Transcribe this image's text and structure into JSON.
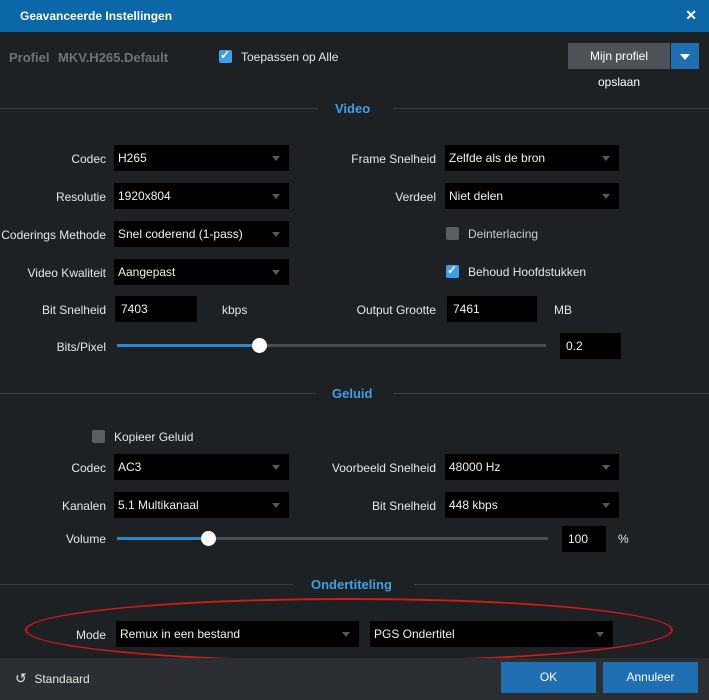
{
  "window": {
    "title": "Geavanceerde Instellingen",
    "close": "✕"
  },
  "profile": {
    "label": "Profiel",
    "name": "MKV.H265.Default",
    "apply_all_label": "Toepassen op Alle",
    "apply_all_checked": true,
    "save_label": "Mijn profiel opslaan"
  },
  "video": {
    "section_title": "Video",
    "codec": {
      "label": "Codec",
      "value": "H265"
    },
    "resolution": {
      "label": "Resolutie",
      "value": "1920x804"
    },
    "encoding_method": {
      "label": "Coderings Methode",
      "value": "Snel coderend (1-pass)"
    },
    "quality": {
      "label": "Video Kwaliteit",
      "value": "Aangepast"
    },
    "bitrate": {
      "label": "Bit Snelheid",
      "value": "7403",
      "unit": "kbps"
    },
    "bits_per_pixel": {
      "label": "Bits/Pixel",
      "value": "0.2",
      "level": 0.33
    },
    "frame_rate": {
      "label": "Frame Snelheid",
      "value": "Zelfde als de bron"
    },
    "split": {
      "label": "Verdeel",
      "value": "Niet delen"
    },
    "deinterlacing": {
      "label": "Deinterlacing",
      "checked": false
    },
    "keep_chapters": {
      "label": "Behoud Hoofdstukken",
      "checked": true
    },
    "output_size": {
      "label": "Output Grootte",
      "value": "7461",
      "unit": "MB"
    }
  },
  "audio": {
    "section_title": "Geluid",
    "copy_audio": {
      "label": "Kopieer Geluid",
      "checked": false
    },
    "codec": {
      "label": "Codec",
      "value": "AC3"
    },
    "channels": {
      "label": "Kanalen",
      "value": "5.1 Multikanaal"
    },
    "volume": {
      "label": "Volume",
      "value": "100",
      "unit": "%",
      "level": 0.21
    },
    "sample_rate": {
      "label": "Voorbeeld Snelheid",
      "value": "48000 Hz"
    },
    "bitrate": {
      "label": "Bit Snelheid",
      "value": "448 kbps"
    }
  },
  "subtitles": {
    "section_title": "Ondertiteling",
    "mode": {
      "label": "Mode",
      "value": "Remux in een bestand"
    },
    "track": {
      "value": "PGS Ondertitel"
    }
  },
  "footer": {
    "reset_icon": "↺",
    "reset_label": "Standaard",
    "ok_label": "OK",
    "cancel_label": "Annuleer"
  },
  "colors": {
    "accent": "#3f9fe6",
    "button": "#1f6fb2",
    "highlight_ring": "#d11a1a"
  }
}
